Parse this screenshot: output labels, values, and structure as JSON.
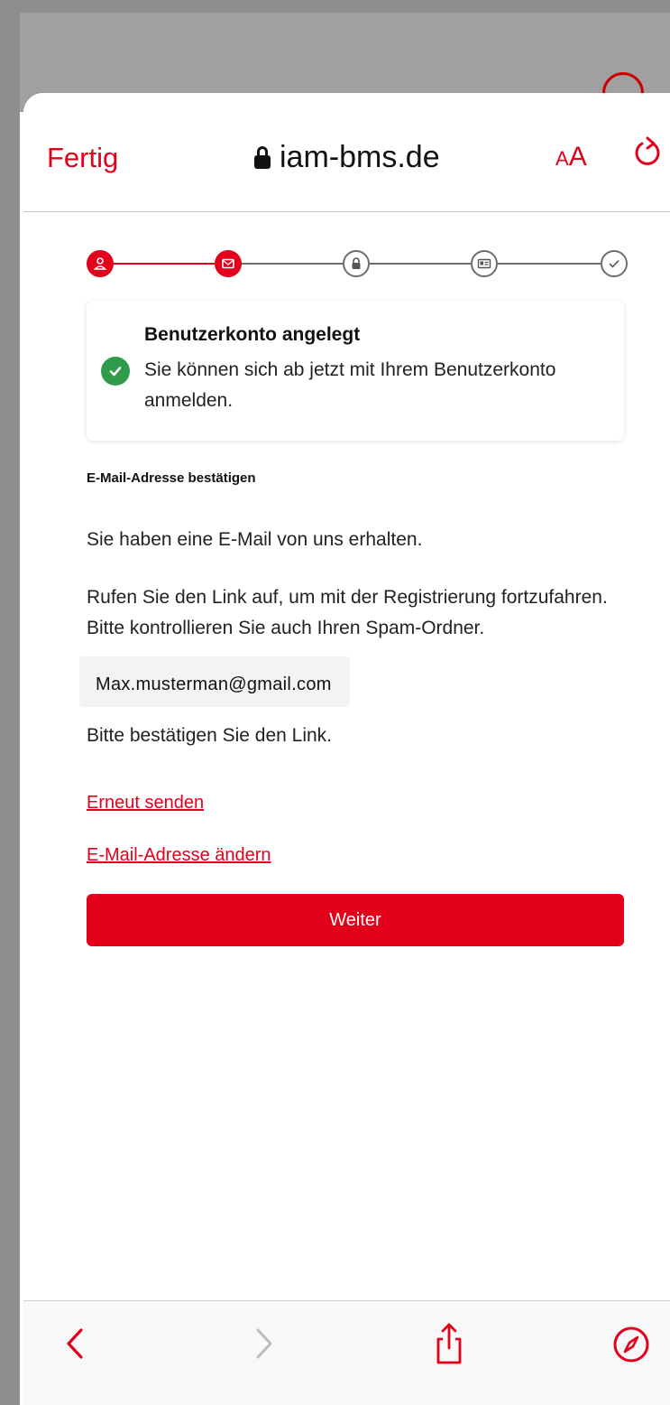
{
  "browser": {
    "done_label": "Fertig",
    "url": "iam-bms.de",
    "text_size_small": "A",
    "text_size_big": "A"
  },
  "stepper": {
    "steps": [
      {
        "name": "user-icon",
        "active": true
      },
      {
        "name": "envelope-icon",
        "active": true
      },
      {
        "name": "lock-icon",
        "active": false
      },
      {
        "name": "id-card-icon",
        "active": false
      },
      {
        "name": "checkmark-icon",
        "active": false
      }
    ]
  },
  "success_card": {
    "title": "Benutzerkonto angelegt",
    "text": "Sie können sich ab jetzt mit Ihrem Benutzerkonto anmelden."
  },
  "main": {
    "section_title": "E-Mail-Adresse bestätigen",
    "info_1": "Sie haben eine E-Mail von uns erhalten.",
    "info_2_line1": "Rufen Sie den Link auf, um mit der Registrierung fortzufahren.",
    "info_2_line2": "Bitte kontrollieren Sie auch Ihren Spam-Ordner.",
    "email": "Max.musterman@gmail.com",
    "confirm_text": "Bitte bestätigen Sie den Link.",
    "resend_link": "Erneut senden",
    "change_email_link": "E-Mail-Adresse ändern",
    "continue_button": "Weiter"
  },
  "colors": {
    "accent": "#e2001a",
    "success": "#2e9a4a",
    "inactive": "#6e6e6e"
  }
}
